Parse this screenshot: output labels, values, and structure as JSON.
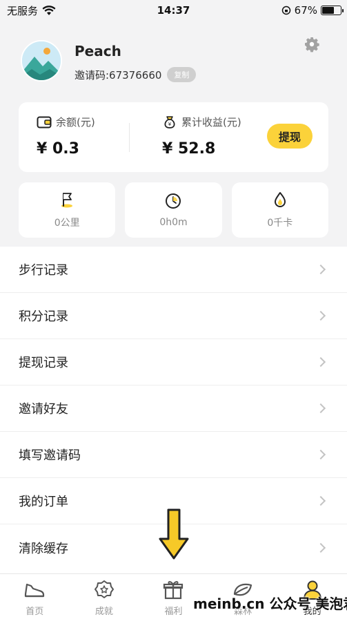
{
  "status_bar": {
    "carrier": "无服务",
    "time": "14:37",
    "battery_percent": "67%",
    "battery_level": 0.67
  },
  "profile": {
    "username": "Peach",
    "invite_code": "邀请码:67376660",
    "copy_label": "复制"
  },
  "balance": {
    "balance_label": "余额(元)",
    "balance_value": "¥ 0.3",
    "earnings_label": "累计收益(元)",
    "earnings_value": "¥ 52.8",
    "withdraw_label": "提现"
  },
  "stats": [
    {
      "icon": "flag-icon",
      "value": "0公里"
    },
    {
      "icon": "clock-icon",
      "value": "0h0m"
    },
    {
      "icon": "flame-icon",
      "value": "0千卡"
    }
  ],
  "menu": [
    {
      "label": "步行记录"
    },
    {
      "label": "积分记录"
    },
    {
      "label": "提现记录"
    },
    {
      "label": "邀请好友"
    },
    {
      "label": "填写邀请码"
    },
    {
      "label": "我的订单"
    },
    {
      "label": "清除缓存"
    }
  ],
  "tabbar": [
    {
      "label": "首页",
      "icon": "shoe-icon"
    },
    {
      "label": "成就",
      "icon": "medal-icon"
    },
    {
      "label": "福利",
      "icon": "gift-icon"
    },
    {
      "label": "森林",
      "icon": "leaf-icon"
    },
    {
      "label": "我的",
      "icon": "user-icon"
    }
  ],
  "watermark": "meinb.cn 公众号 美泡君",
  "colors": {
    "accent": "#fbd23a",
    "background": "#f3f3f4"
  }
}
